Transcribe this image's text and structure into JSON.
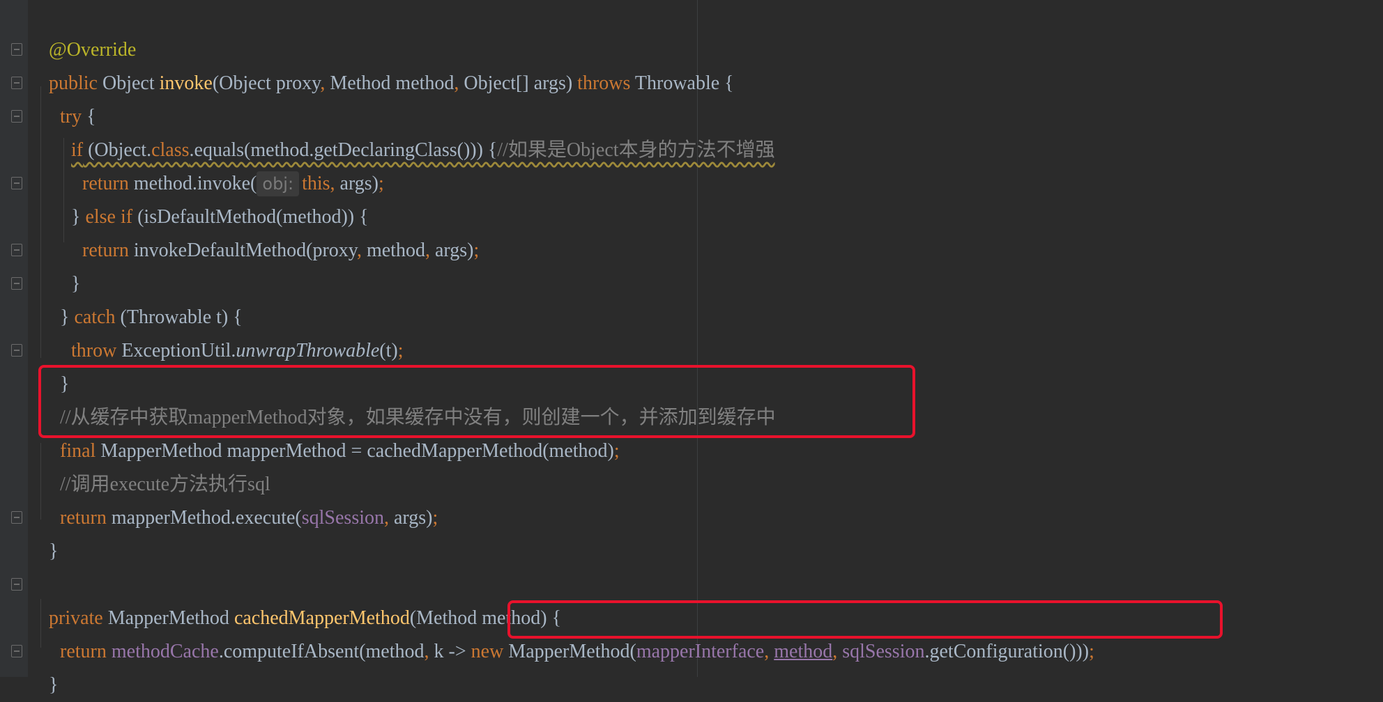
{
  "editor": {
    "theme_colors": {
      "background": "#2b2b2b",
      "keyword": "#cc7832",
      "method_decl": "#ffc66d",
      "annotation": "#bbb529",
      "comment": "#808080",
      "field": "#9876aa",
      "text": "#a9b7c6",
      "highlight_box": "#e8122c"
    },
    "lines": {
      "l1_annotation": "@Override",
      "l2_public": "public",
      "l2_object": " Object ",
      "l2_invoke": "invoke",
      "l2_params1": "(Object proxy",
      "l2_comma1": ", ",
      "l2_params2": "Method method",
      "l2_comma2": ", ",
      "l2_params3": "Object[] args) ",
      "l2_throws": "throws",
      "l2_rest": " Throwable {",
      "l3_try": "try",
      "l3_rest": " {",
      "l4_if": "if",
      "l4_p1": " (Object.",
      "l4_class": "class",
      "l4_p2": ".equals(method.getDeclaringClass())) {",
      "l4_comment": "//如果是Object本身的方法不增强",
      "l5_return": "return",
      "l5_p1": " method.invoke(",
      "l5_hint": "obj:",
      "l5_this": "this",
      "l5_comma": ", ",
      "l5_p2": "args)",
      "l5_semi": ";",
      "l6_brace": "} ",
      "l6_else": "else if",
      "l6_rest": " (isDefaultMethod(method)) {",
      "l7_return": "return",
      "l7_p1": " invokeDefaultMethod(proxy",
      "l7_c1": ", ",
      "l7_p2": "method",
      "l7_c2": ", ",
      "l7_p3": "args)",
      "l7_semi": ";",
      "l8_brace": "}",
      "l9_brace": "} ",
      "l9_catch": "catch",
      "l9_rest": " (Throwable t) {",
      "l10_throw": "throw",
      "l10_p1": " ExceptionUtil.",
      "l10_method": "unwrapThrowable",
      "l10_p2": "(t)",
      "l10_semi": ";",
      "l11_brace": "}",
      "l12_comment": "//从缓存中获取mapperMethod对象，如果缓存中没有，则创建一个，并添加到缓存中",
      "l13_final": "final",
      "l13_rest": " MapperMethod mapperMethod = cachedMapperMethod(method)",
      "l13_semi": ";",
      "l14_comment": "//调用execute方法执行sql",
      "l15_return": "return",
      "l15_p1": " mapperMethod.execute(",
      "l15_field": "sqlSession",
      "l15_comma": ", ",
      "l15_p2": "args)",
      "l15_semi": ";",
      "l16_brace": "}",
      "l18_private": "private",
      "l18_p1": " MapperMethod ",
      "l18_name": "cachedMapperMethod",
      "l18_rest": "(Method method) {",
      "l19_return": "return",
      "l19_sp": " ",
      "l19_field1": "methodCache",
      "l19_p1": ".computeIfAbsent(method",
      "l19_comma1": ", ",
      "l19_p2": "k -> ",
      "l19_new": "new",
      "l19_p3": " MapperMethod(",
      "l19_field2": "mapperInterface",
      "l19_comma2": ", ",
      "l19_method": "method",
      "l19_comma3": ", ",
      "l19_field3": "sqlSession",
      "l19_p4": ".getConfiguration()))",
      "l19_semi": ";",
      "l20_brace": "}"
    }
  }
}
